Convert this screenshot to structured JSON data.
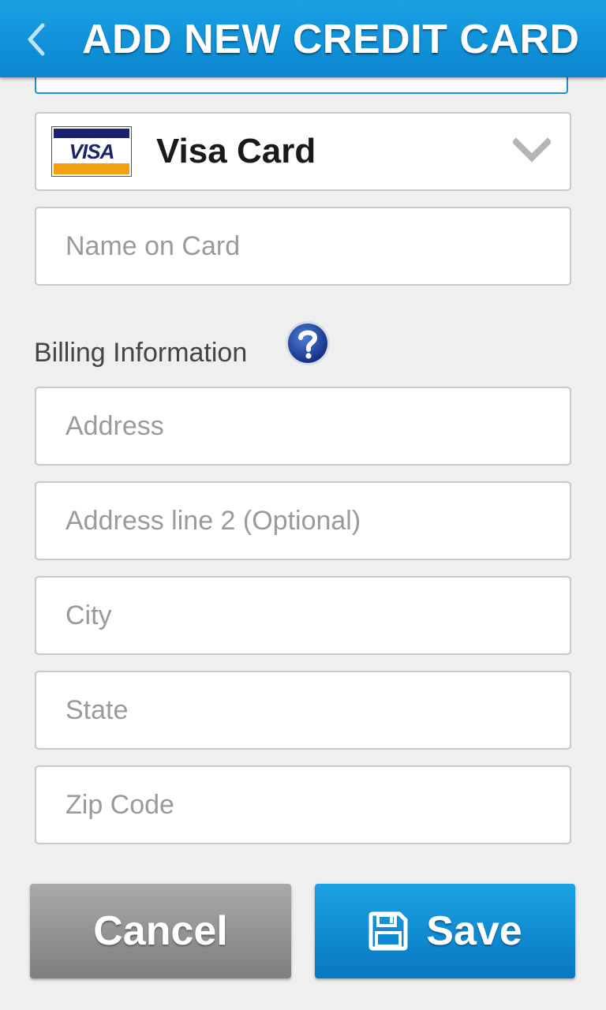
{
  "header": {
    "title": "ADD NEW CREDIT CARD",
    "back_icon": "chevron-left-icon"
  },
  "card_type": {
    "logo_text": "VISA",
    "selected_label": "Visa Card",
    "dropdown_icon": "chevron-down-icon"
  },
  "name_field": {
    "placeholder": "Name on Card",
    "value": ""
  },
  "billing": {
    "section_label": "Billing Information",
    "help_icon": "question-mark-icon",
    "address": {
      "placeholder": "Address",
      "value": ""
    },
    "address2": {
      "placeholder": "Address line 2 (Optional)",
      "value": ""
    },
    "city": {
      "placeholder": "City",
      "value": ""
    },
    "state": {
      "placeholder": "State",
      "value": ""
    },
    "zip": {
      "placeholder": "Zip Code",
      "value": ""
    }
  },
  "actions": {
    "cancel_label": "Cancel",
    "save_label": "Save",
    "save_icon": "floppy-disk-icon"
  },
  "colors": {
    "header_blue": "#0a86cf",
    "save_blue": "#0a86cf",
    "cancel_gray": "#8f8f8f",
    "visa_blue": "#1a2270",
    "visa_gold": "#f2a20f"
  }
}
